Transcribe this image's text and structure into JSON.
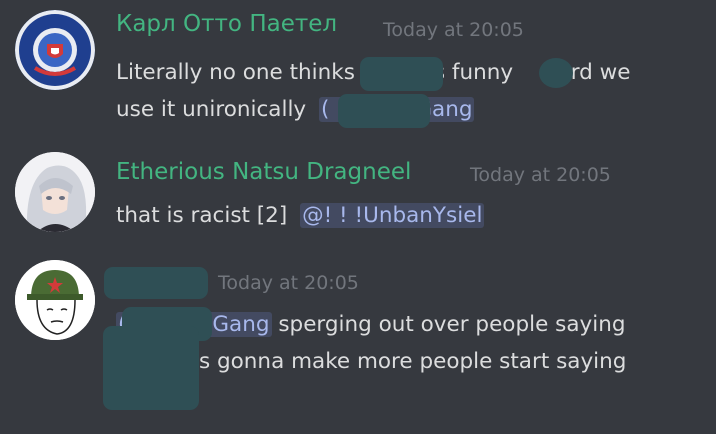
{
  "theme": {
    "background": "#36393f",
    "name_color": "#43b581",
    "mention_color": "#a8b8ec",
    "timestamp_color": "#72767d",
    "redaction_color": "#2f4f55"
  },
  "messages": [
    {
      "author": "Карл Отто Паетел",
      "timestamp": "Today at 20:05",
      "avatar_text": {
        "top": "НАРОДНА ОДБРАНА",
        "bottom": "ПЕТРОВАЦ"
      },
      "line1": {
        "part1": "Literally no one thinks",
        "part2": "is funny",
        "part3": "tard we"
      },
      "line2": {
        "part1": "use it unironically",
        "mention_open": "(",
        "mention_tail": "Gang"
      }
    },
    {
      "author": "Etherious Natsu Dragneel",
      "timestamp": "Today at 20:05",
      "text": "that is racist [2]",
      "mention": "@! ! !UnbanYsiel"
    },
    {
      "author": "",
      "timestamp": "Today at 20:05",
      "line1": {
        "mention_open": "(",
        "mention_tail": "Gang",
        "text": "sperging out over people saying"
      },
      "line2": {
        "text": "is gonna make more people start saying"
      }
    }
  ]
}
